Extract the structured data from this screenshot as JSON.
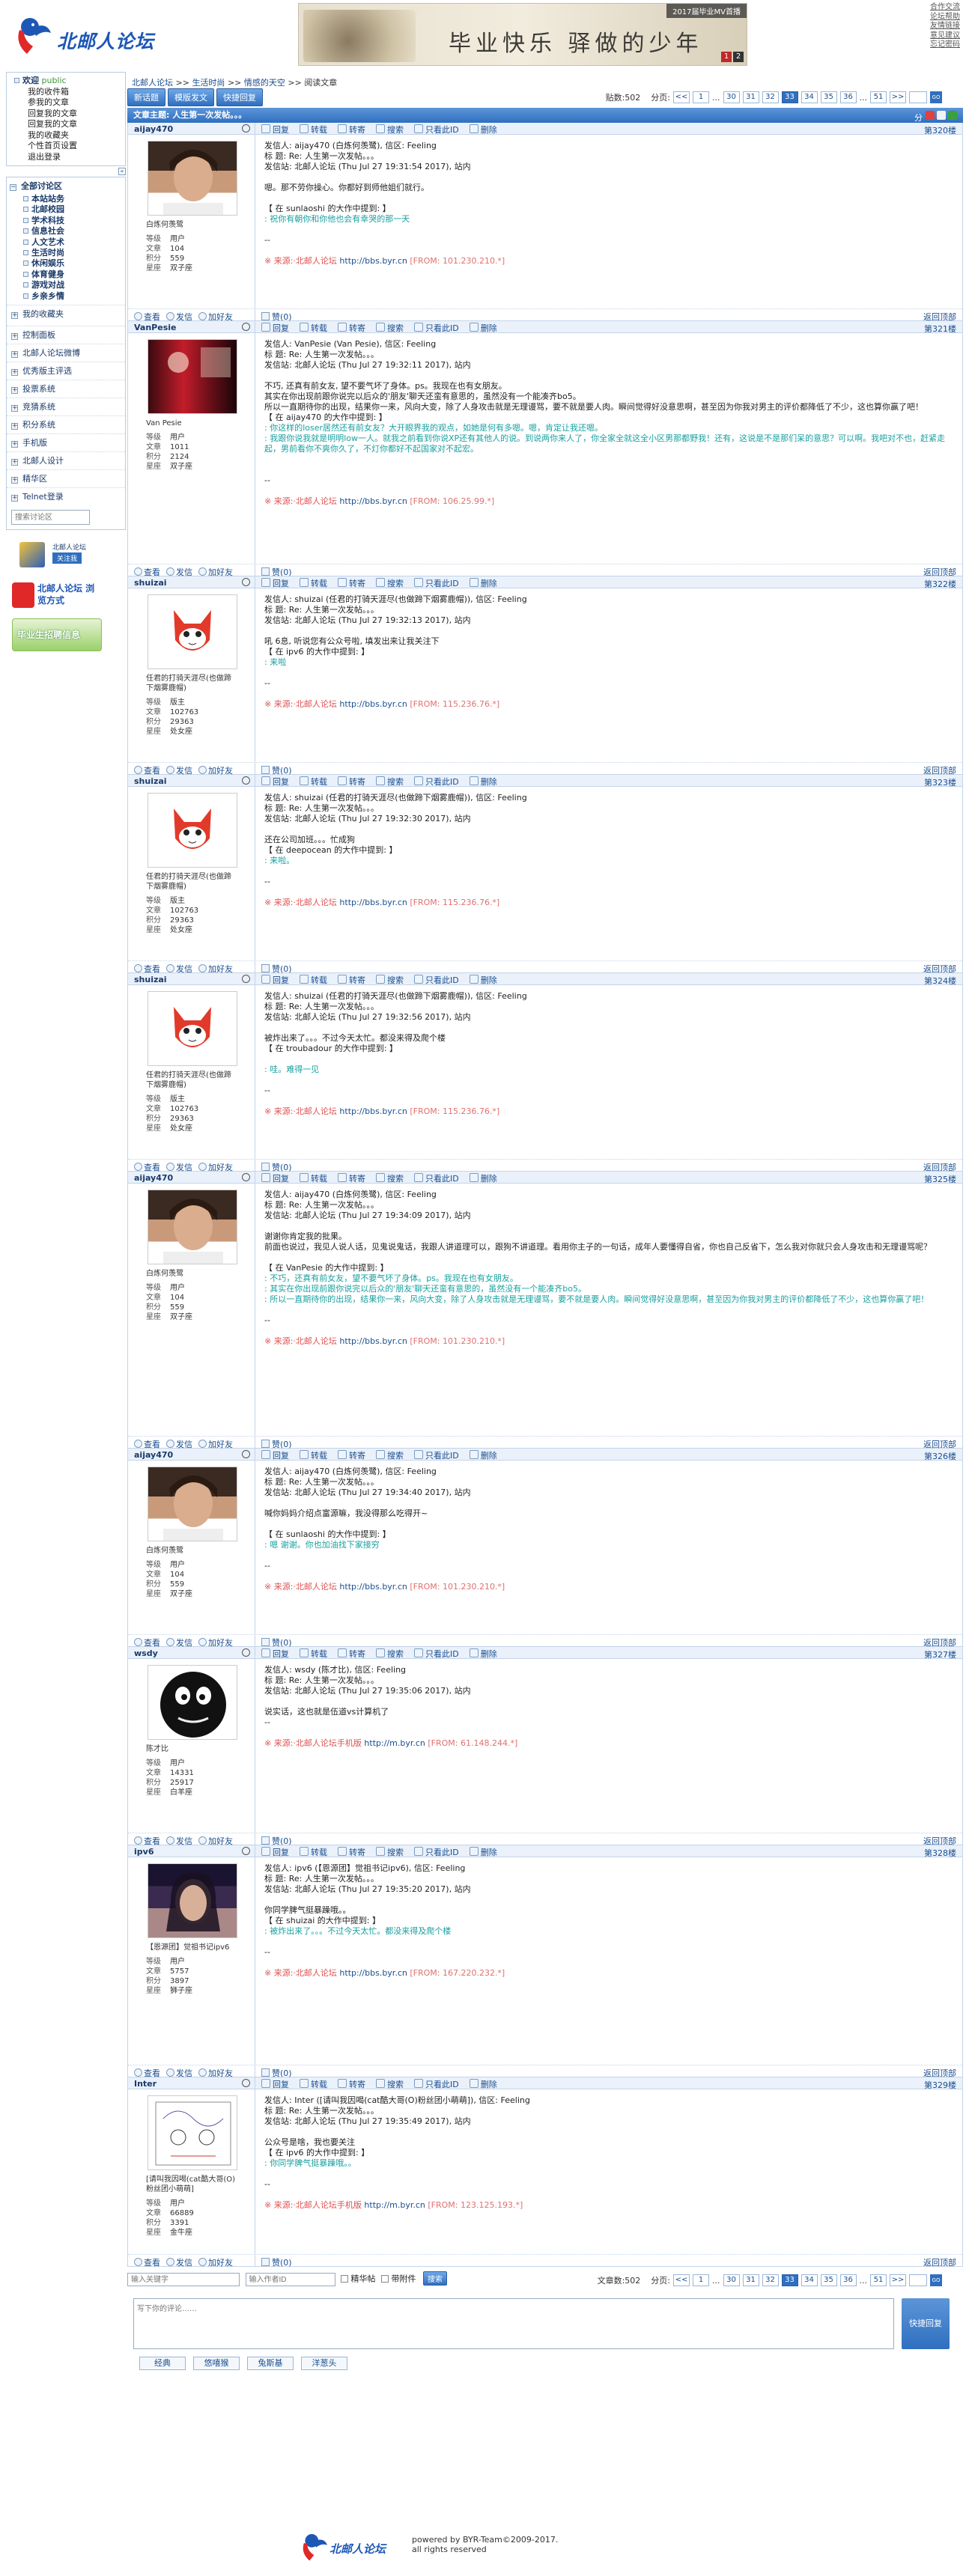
{
  "header": {
    "logo_text": "北邮人论坛",
    "banner_caption": "2017届毕业MV首播",
    "banner_calligraphy": "毕业快乐 驿做的少年",
    "banner_pages": [
      "1",
      "2"
    ],
    "top_links": [
      "合作交流",
      "论坛帮助",
      "友情链接",
      "意见建议",
      "忘记密码"
    ]
  },
  "sidebar": {
    "welcome_label": "欢迎",
    "username": "public",
    "user_links": [
      "我的收件箱",
      "参我的文章",
      "回复我的文章",
      "回复我的文章",
      "我的收藏夹",
      "个性首页设置",
      "退出登录"
    ],
    "all_sections": "全部讨论区",
    "sections": [
      "本站站务",
      "北邮校园",
      "学术科技",
      "信息社会",
      "人文艺术",
      "生活时尚",
      "休闲娱乐",
      "体育健身",
      "游戏对战",
      "乡亲乡情"
    ],
    "my_fav": "我的收藏夹",
    "control": "控制面板",
    "items": [
      "北邮人论坛微博",
      "优秀版主评选",
      "投票系统",
      "竞猜系统",
      "积分系统",
      "手机版",
      "北邮人设计",
      "精华区",
      "Telnet登录"
    ],
    "search_placeholder": "搜索讨论区",
    "promo1_title": "北邮人论坛",
    "promo1_btn": "关注我",
    "promo2": "北邮人论坛 浏览方式",
    "promo3": "毕业生招聘信息"
  },
  "breadcrumb": [
    "北邮人论坛",
    ">>",
    "生活时尚",
    ">>",
    "情感的天空",
    ">>",
    "阅读文章"
  ],
  "toolbar": {
    "buttons": [
      "新话题",
      "模版发文",
      "快捷回复"
    ],
    "post_count_label": "贴数:502",
    "pages_label": "分页:",
    "pages": [
      "<<",
      "1",
      "...",
      "30",
      "31",
      "32",
      "33",
      "34",
      "35",
      "36",
      "...",
      "51",
      ">>"
    ],
    "current_page": "33",
    "go_label": "GO"
  },
  "thread_title": "文章主题: 人生第一次发帖。。。",
  "share_label": "分享到:",
  "post_actions": [
    "回复",
    "转载",
    "转寄",
    "搜索",
    "只看此ID",
    "删除"
  ],
  "foot_actions": [
    "查看",
    "发信",
    "加好友"
  ],
  "like_label": "赞(0)",
  "back_top": "返回顶部",
  "profile_keys": [
    "等级",
    "文章",
    "积分",
    "星座"
  ],
  "posts": [
    {
      "user": "aijay470",
      "floor": "第320楼",
      "title": "白炼何羡鹭",
      "stats": [
        "用户",
        "104",
        "559",
        "双子座"
      ],
      "lines": [
        "发信人: aijay470 (白炼何羡鹭), 信区: Feeling",
        "标  题: Re: 人生第一次发帖。。。",
        "发信站: 北邮人论坛 (Thu Jul 27 19:31:54 2017), 站内",
        "",
        "嗯。那不劳你操心。你都好到师他姐们就行。",
        "",
        "【 在 sunlaoshi 的大作中提到: 】"
      ],
      "quote": [
        ": 祝你有朝你和你他也会有幸哭的那一天"
      ],
      "after": [
        "",
        "--",
        ""
      ],
      "src": "※ 来源:·北邮人论坛",
      "src_url": "http://bbs.byr.cn",
      "ip": "[FROM: 101.230.210.*]"
    },
    {
      "user": "VanPesie",
      "floor": "第321楼",
      "title": "Van Pesie",
      "stats": [
        "用户",
        "1011",
        "2124",
        "双子座"
      ],
      "lines": [
        "发信人: VanPesie (Van Pesie), 信区: Feeling",
        "标  题: Re: 人生第一次发帖。。。",
        "发信站: 北邮人论坛 (Thu Jul 27 19:32:11 2017), 站内",
        "",
        "不巧, 还真有前女友, 望不要气坏了身体。ps。我现在也有女朋友。",
        "其实在你出现前跟你说完以后众的'朋友'聊天还蛮有意思的，虽然没有一个能凑齐bo5。",
        "所以一直期待你的出现，结果你一来，风向大变，除了人身攻击就是无理谩骂，要不就是要人肉。瞬间觉得好没意思啊，甚至因为你我对男主的评价都降低了不少，这也算你赢了吧！",
        "【 在 aijay470 的大作中提到: 】"
      ],
      "quote": [
        ": 你这样的loser居然还有前女友？大开眼界我的观点，如她是何有多嗯。嗯，肯定让我还嗯。",
        ": 我跟你说我就是明明low一人。就我之前看到你说XP还有其他人的说。到说两你来人了，你全家全就这全小区男那都野我！还有，这说是不是那们呆的意思？可以啊。我吧对不也，赶紧走起，男前看你不爽你久了，不灯你都好不起国家对不起宏。"
      ],
      "after": [
        "",
        "",
        "--",
        ""
      ],
      "src": "※ 来源:·北邮人论坛",
      "src_url": "http://bbs.byr.cn",
      "ip": "[FROM: 106.25.99.*]"
    },
    {
      "user": "shuizai",
      "floor": "第322楼",
      "title": "任君的打骑天涯尽(也做蹄下烟雾鹿帽)",
      "stats": [
        "版主",
        "102763",
        "29363",
        "处女座"
      ],
      "lines": [
        "发信人: shuizai (任君的打骑天涯尽(也做蹄下烟雾鹿帽)), 信区: Feeling",
        "标  题: Re: 人生第一次发帖。。。",
        "发信站: 北邮人论坛 (Thu Jul 27 19:32:13 2017), 站内",
        "",
        "吼 6息, 听说您有公众号啦, 填发出来让我关注下",
        "【 在 ipv6 的大作中提到: 】"
      ],
      "quote": [
        ": 来啦"
      ],
      "after": [
        "",
        "--",
        ""
      ],
      "src": "※ 来源:·北邮人论坛",
      "src_url": "http://bbs.byr.cn",
      "ip": "[FROM: 115.236.76.*]"
    },
    {
      "user": "shuizai",
      "floor": "第323楼",
      "title": "任君的打骑天涯尽(也做蹄下烟雾鹿帽)",
      "stats": [
        "版主",
        "102763",
        "29363",
        "处女座"
      ],
      "lines": [
        "发信人: shuizai (任君的打骑天涯尽(也做蹄下烟雾鹿帽)), 信区: Feeling",
        "标  题: Re: 人生第一次发帖。。。",
        "发信站: 北邮人论坛 (Thu Jul 27 19:32:30 2017), 站内",
        "",
        "还在公司加班。。。忙成狗",
        "【 在 deepocean 的大作中提到: 】"
      ],
      "quote": [
        ": 来啦。"
      ],
      "after": [
        "",
        "--",
        ""
      ],
      "src": "※ 来源:·北邮人论坛",
      "src_url": "http://bbs.byr.cn",
      "ip": "[FROM: 115.236.76.*]"
    },
    {
      "user": "shuizai",
      "floor": "第324楼",
      "title": "任君的打骑天涯尽(也做蹄下烟雾鹿帽)",
      "stats": [
        "版主",
        "102763",
        "29363",
        "处女座"
      ],
      "lines": [
        "发信人: shuizai (任君的打骑天涯尽(也做蹄下烟雾鹿帽)), 信区: Feeling",
        "标  题: Re: 人生第一次发帖。。。",
        "发信站: 北邮人论坛 (Thu Jul 27 19:32:56 2017), 站内",
        "",
        "被炸出来了。。。不过今天太忙。都没来得及爬个楼",
        "【 在 troubadour 的大作中提到: 】",
        ""
      ],
      "quote": [
        ": 哇。难得一见"
      ],
      "after": [
        "",
        "--",
        ""
      ],
      "src": "※ 来源:·北邮人论坛",
      "src_url": "http://bbs.byr.cn",
      "ip": "[FROM: 115.236.76.*]"
    },
    {
      "user": "aijay470",
      "floor": "第325楼",
      "title": "白炼何羡鹭",
      "stats": [
        "用户",
        "104",
        "559",
        "双子座"
      ],
      "lines": [
        "发信人: aijay470 (白炼何羡鹭), 信区: Feeling",
        "标  题: Re: 人生第一次发帖。。。",
        "发信站: 北邮人论坛 (Thu Jul 27 19:34:09 2017), 站内",
        "",
        "谢谢你肯定我的批果。",
        "前面也说过，我见人说人话，见鬼说鬼话，我跟人讲道理可以，跟狗不讲道理。看用你主子的一句话，成年人要懂得自省，你也自己反省下，怎么我对你就只会人身攻击和无理谩骂呢？",
        "",
        "【 在 VanPesie 的大作中提到: 】"
      ],
      "quote": [
        ": 不巧，还真有前女友，望不要气坏了身体。ps。我现在也有女朋友。",
        ": 其实在你出现前跟你说完以后众的'朋友'聊天还蛮有意思的，虽然没有一个能凑齐bo5。",
        ": 所以一直期待你的出现，结果你一来，风向大变，除了人身攻击就是无理谩骂，要不就是要人肉。瞬间觉得好没意思啊，甚至因为你我对男主的评价都降低了不少，这也算你赢了吧！"
      ],
      "after": [
        "",
        "--",
        ""
      ],
      "src": "※ 来源:·北邮人论坛",
      "src_url": "http://bbs.byr.cn",
      "ip": "[FROM: 101.230.210.*]"
    },
    {
      "user": "aijay470",
      "floor": "第326楼",
      "title": "白炼何羡鹭",
      "stats": [
        "用户",
        "104",
        "559",
        "双子座"
      ],
      "lines": [
        "发信人: aijay470 (白炼何羡鹭), 信区: Feeling",
        "标  题: Re: 人生第一次发帖。。。",
        "发信站: 北邮人论坛 (Thu Jul 27 19:34:40 2017), 站内",
        "",
        "喊你妈妈介绍点富源嘛，我没得那么吃得开~",
        "",
        "【 在 sunlaoshi 的大作中提到: 】"
      ],
      "quote": [
        ": 嗯 谢谢。你也加油找下家接穷"
      ],
      "after": [
        "",
        "--",
        ""
      ],
      "src": "※ 来源:·北邮人论坛",
      "src_url": "http://bbs.byr.cn",
      "ip": "[FROM: 101.230.210.*]"
    },
    {
      "user": "wsdy",
      "floor": "第327楼",
      "title": "陈才比",
      "stats": [
        "用户",
        "14331",
        "25917",
        "白羊座"
      ],
      "lines": [
        "发信人: wsdy (陈才比), 信区: Feeling",
        "标  题: Re: 人生第一次发帖。。。",
        "发信站: 北邮人论坛 (Thu Jul 27 19:35:06 2017), 站内",
        "",
        "说实话，这也就是伍道vs计算机了",
        "--",
        ""
      ],
      "quote": [],
      "after": [],
      "src": "※ 来源:·北邮人论坛手机版",
      "src_url": "http://m.byr.cn",
      "ip": "[FROM: 61.148.244.*]"
    },
    {
      "user": "ipv6",
      "floor": "第328楼",
      "title": "【恩源团】觉祖书记ipv6",
      "stats": [
        "用户",
        "5757",
        "3897",
        "狮子座"
      ],
      "lines": [
        "发信人: ipv6 (【恩源团】觉祖书记ipv6), 信区: Feeling",
        "标  题: Re: 人生第一次发帖。。。",
        "发信站: 北邮人论坛 (Thu Jul 27 19:35:20 2017), 站内",
        "",
        "你同学脾气挺暴躁哦。。",
        "【 在 shuizai 的大作中提到: 】"
      ],
      "quote": [
        ": 被炸出来了。。。不过今天太忙。都没来得及爬个楼"
      ],
      "after": [
        "",
        "--",
        ""
      ],
      "src": "※ 来源:·北邮人论坛",
      "src_url": "http://bbs.byr.cn",
      "ip": "[FROM: 167.220.232.*]"
    },
    {
      "user": "Inter",
      "floor": "第329楼",
      "title": "[请叫我因喝(cat酷大哥(O)粉丝团小萌萌]",
      "stats": [
        "用户",
        "66889",
        "3391",
        "金牛座"
      ],
      "lines": [
        "发信人: Inter ([请叫我因喝(cat酷大哥(O)粉丝团小萌萌]), 信区: Feeling",
        "标  题: Re: 人生第一次发帖。。。",
        "发信站: 北邮人论坛 (Thu Jul 27 19:35:49 2017), 站内",
        "",
        "公众号是啥，我也要关注",
        "【 在 ipv6 的大作中提到: 】"
      ],
      "quote": [
        ": 你同学脾气挺暴躁哦。。"
      ],
      "after": [
        "",
        "--",
        ""
      ],
      "src": "※ 来源:·北邮人论坛手机版",
      "src_url": "http://m.byr.cn",
      "ip": "[FROM: 123.125.193.*]"
    }
  ],
  "bottom": {
    "keyword_placeholder": "输入关键字",
    "author_placeholder": "输入作者ID",
    "digest_label": "精华帖",
    "attach_label": "带附件",
    "search_btn": "搜索",
    "post_count": "文章数:502",
    "reply_placeholder": "写下你的评论……",
    "quick_reply": "快捷回复",
    "tabs": [
      "经典",
      "悠嘻猴",
      "兔斯基",
      "洋葱头"
    ]
  },
  "footer": {
    "logo_text": "北邮人论坛",
    "powered": "powered by BYR-Team©2009-2017.",
    "rights": "all rights reserved"
  },
  "colors": {
    "accent": "#2f6fc0",
    "quote": "#1aa0a0",
    "source": "#e05050"
  }
}
